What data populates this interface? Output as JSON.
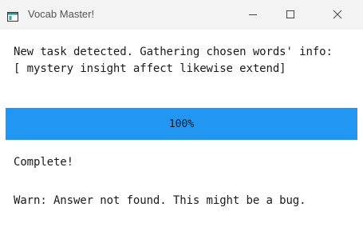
{
  "window": {
    "title": "Vocab Master!"
  },
  "message": {
    "line1": "New task detected. Gathering chosen words' info:",
    "line2": "[ mystery insight affect likewise extend]"
  },
  "progress": {
    "value": 1.0,
    "label": "100%",
    "color": "#2196f3"
  },
  "status": {
    "text": "Complete!"
  },
  "warning": {
    "text": "Warn: Answer not found. This might be a bug."
  },
  "icons": {
    "app": "app-window-icon",
    "minimize": "minimize-icon",
    "maximize": "maximize-icon",
    "close": "close-icon"
  }
}
